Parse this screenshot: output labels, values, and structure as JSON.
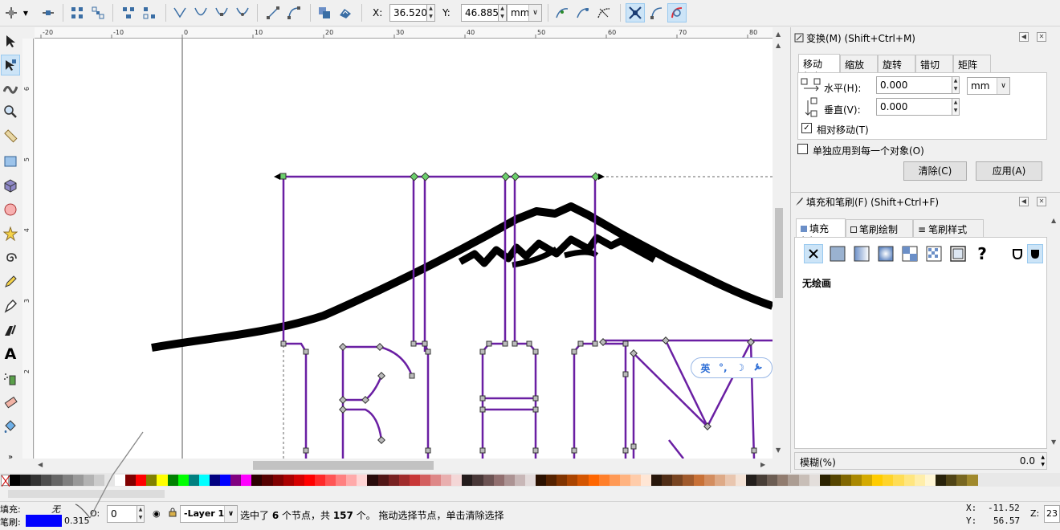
{
  "toolbar": {
    "x_label": "X:",
    "x_value": "36.520",
    "y_label": "Y:",
    "y_value": "46.885",
    "unit": "mm"
  },
  "ruler": {
    "h_ticks": [
      "-20",
      "-10",
      "0",
      "10",
      "20",
      "30",
      "40",
      "50",
      "60",
      "70",
      "80"
    ],
    "v_ticks": [
      "6",
      "5",
      "4",
      "3",
      "2"
    ]
  },
  "ime": {
    "lang": "英",
    "punct": "°,",
    "moon": "☽",
    "wrench": "🔧"
  },
  "transform": {
    "title": "变换(M) (Shift+Ctrl+M)",
    "tabs": [
      "移动(M)",
      "缩放(S)",
      "旋转(R)",
      "错切(W)",
      "矩阵(X)"
    ],
    "h_label": "水平(H):",
    "h_value": "0.000",
    "v_label": "垂直(V):",
    "v_value": "0.000",
    "unit": "mm",
    "relative_label": "相对移动(T)",
    "relative_checked": true,
    "each_label": "单独应用到每一个对象(O)",
    "each_checked": false,
    "clear_label": "清除(C)",
    "apply_label": "应用(A)"
  },
  "fillstroke": {
    "title": "填充和笔刷(F) (Shift+Ctrl+F)",
    "tabs": [
      "填充(F)",
      "笔刷绘制(P)",
      "笔刷样式(Y)"
    ],
    "no_paint_label": "无绘画",
    "unknown_icon": "?",
    "blur_label": "模糊(%)",
    "blur_value": "0.0"
  },
  "status": {
    "fill_label": "填充:",
    "fill_value": "无",
    "stroke_label": "笔刷:",
    "stroke_width": "0.315",
    "stroke_color": "#0000ff",
    "opacity_label": "O:",
    "opacity_value": "0",
    "layer": "-Layer 1",
    "message_a": "选中了 ",
    "message_count": "6",
    "message_b": " 个节点，共 ",
    "message_total": "157",
    "message_c": " 个。 拖动选择节点，单击清除选择",
    "cursor_x_label": "X:",
    "cursor_x": "-11.52",
    "cursor_y_label": "Y:",
    "cursor_y": "56.57",
    "zoom_label": "Z:",
    "zoom": "23"
  },
  "palette": [
    "#000000",
    "#1a1a1a",
    "#333333",
    "#4d4d4d",
    "#666666",
    "#808080",
    "#999999",
    "#b3b3b3",
    "#cccccc",
    "#e6e6e6",
    "#ffffff",
    "#800000",
    "#ff0000",
    "#808000",
    "#ffff00",
    "#008000",
    "#00ff00",
    "#008080",
    "#00ffff",
    "#000080",
    "#0000ff",
    "#800080",
    "#ff00ff",
    "#2b0000",
    "#550000",
    "#800000",
    "#aa0000",
    "#d40000",
    "#ff0000",
    "#ff2a2a",
    "#ff5555",
    "#ff8080",
    "#ffaaaa",
    "#ffd5d5",
    "#280b0b",
    "#501616",
    "#782121",
    "#a02c2c",
    "#c83737",
    "#d35f5f",
    "#de8787",
    "#e9afaf",
    "#f4d7d7",
    "#241c1c",
    "#483737",
    "#6c5353",
    "#916f6f",
    "#ac9393",
    "#c8b7b7",
    "#e3dbdb",
    "#2b1100",
    "#552200",
    "#803300",
    "#aa4400",
    "#d45500",
    "#ff6600",
    "#ff7f2a",
    "#ff9955",
    "#ffb380",
    "#ffccaa",
    "#ffe6d5",
    "#28170b",
    "#502d16",
    "#784421",
    "#a05a2c",
    "#c87137",
    "#d38d5f",
    "#deaa87",
    "#e9c6af",
    "#f4e3d7",
    "#241f1c",
    "#483e37",
    "#6c5d53",
    "#917c6f",
    "#ac9d93",
    "#c8beb7",
    "#e3dedb",
    "#2b2200",
    "#554400",
    "#806600",
    "#aa8800",
    "#d4aa00",
    "#ffcc00",
    "#ffd42a",
    "#ffdd55",
    "#ffe680",
    "#ffeeaa",
    "#fff6d5",
    "#28220b",
    "#504416",
    "#786721",
    "#a0892c"
  ]
}
